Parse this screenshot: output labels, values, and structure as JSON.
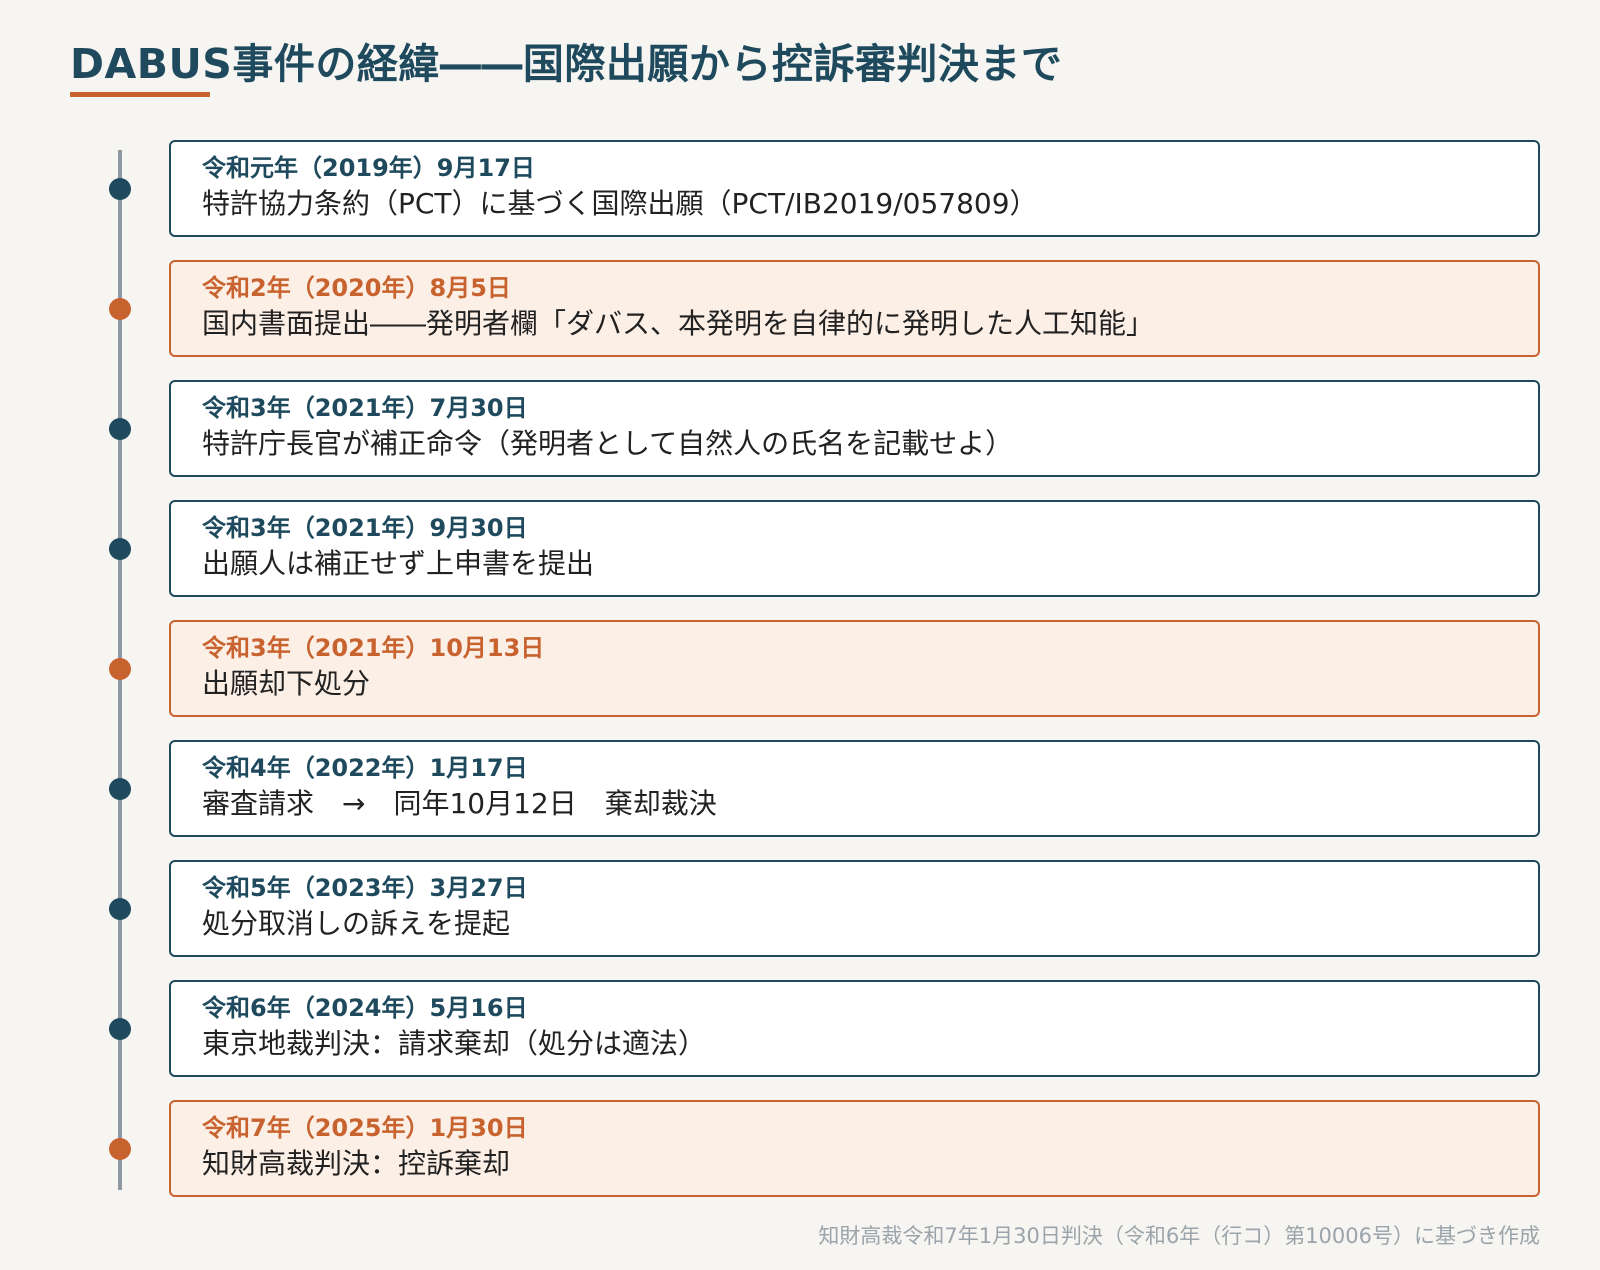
{
  "title": "DABUS事件の経緯――国際出願から控訴審判決まで",
  "colors": {
    "primary": "#1f4a5e",
    "accent": "#c8632f",
    "highlight_bg": "#fcefe6"
  },
  "events": [
    {
      "date": "令和元年（2019年）9月17日",
      "text": "特許協力条約（PCT）に基づく国際出願（PCT/IB2019/057809）",
      "highlight": false
    },
    {
      "date": "令和2年（2020年）8月5日",
      "text": "国内書面提出――発明者欄「ダバス、本発明を自律的に発明した人工知能」",
      "highlight": true
    },
    {
      "date": "令和3年（2021年）7月30日",
      "text": "特許庁長官が補正命令（発明者として自然人の氏名を記載せよ）",
      "highlight": false
    },
    {
      "date": "令和3年（2021年）9月30日",
      "text": "出願人は補正せず上申書を提出",
      "highlight": false
    },
    {
      "date": "令和3年（2021年）10月13日",
      "text": "出願却下処分",
      "highlight": true
    },
    {
      "date": "令和4年（2022年）1月17日",
      "text": "審査請求　→　同年10月12日　棄却裁決",
      "highlight": false
    },
    {
      "date": "令和5年（2023年）3月27日",
      "text": "処分取消しの訴えを提起",
      "highlight": false
    },
    {
      "date": "令和6年（2024年）5月16日",
      "text": "東京地裁判決：請求棄却（処分は適法）",
      "highlight": false
    },
    {
      "date": "令和7年（2025年）1月30日",
      "text": "知財高裁判決：控訴棄却",
      "highlight": true
    }
  ],
  "source": "知財高裁令和7年1月30日判決（令和6年（行コ）第10006号）に基づき作成"
}
